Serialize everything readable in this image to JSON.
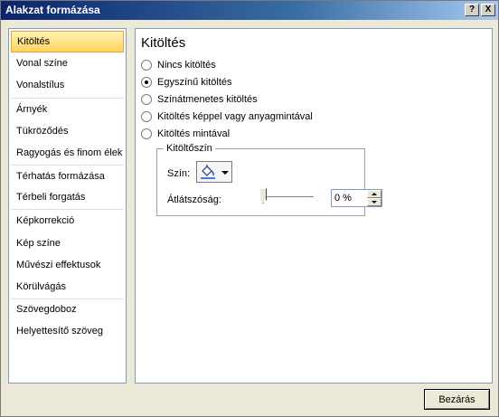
{
  "window": {
    "title": "Alakzat formázása",
    "help_label": "?",
    "close_label": "X"
  },
  "sidebar": {
    "items": [
      {
        "label": "Kitöltés",
        "selected": true
      },
      {
        "label": "Vonal színe"
      },
      {
        "label": "Vonalstílus"
      },
      {
        "label": "Árnyék"
      },
      {
        "label": "Tükröződés"
      },
      {
        "label": "Ragyogás és finom élek"
      },
      {
        "label": "Térhatás formázása"
      },
      {
        "label": "Térbeli forgatás"
      },
      {
        "label": "Képkorrekció"
      },
      {
        "label": "Kép színe"
      },
      {
        "label": "Művészi effektusok"
      },
      {
        "label": "Körülvágás"
      },
      {
        "label": "Szövegdoboz"
      },
      {
        "label": "Helyettesítő szöveg"
      }
    ]
  },
  "panel": {
    "title": "Kitöltés",
    "radios": [
      {
        "label": "Nincs kitöltés",
        "checked": false
      },
      {
        "label": "Egyszínű kitöltés",
        "checked": true
      },
      {
        "label": "Színátmenetes kitöltés",
        "checked": false
      },
      {
        "label": "Kitöltés képpel vagy anyagmintával",
        "checked": false
      },
      {
        "label": "Kitöltés mintával",
        "checked": false
      }
    ],
    "fill_group": {
      "legend": "Kitöltőszín",
      "color_label": "Szín:",
      "transparency_label": "Átlátszóság:",
      "transparency_value": "0 %",
      "transparency_fraction": 0
    }
  },
  "footer": {
    "close_button": "Bezárás"
  },
  "colors": {
    "title_bar_start": "#0a246a",
    "selected_item": "#ffd45c"
  }
}
